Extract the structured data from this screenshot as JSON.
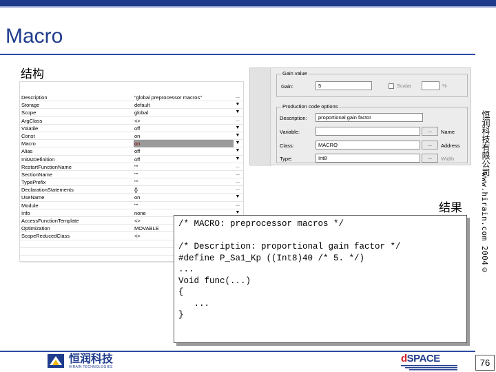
{
  "slide": {
    "title": "Macro",
    "section_heading": "结构",
    "result_heading": "结果",
    "company_vertical": "恒润科技有限公司",
    "url_vertical": "www.hirain.com 2004©",
    "page_number": "76"
  },
  "property_grid": {
    "rows": [
      {
        "name": "Description",
        "value": "\"global preprocessor macros\"",
        "control": "..."
      },
      {
        "name": "Storage",
        "value": "default",
        "control": "▼"
      },
      {
        "name": "Scope",
        "value": "global",
        "control": "▼"
      },
      {
        "name": "ArgClass",
        "value": "<>",
        "control": "..."
      },
      {
        "name": "Volatile",
        "value": "off",
        "control": "▼"
      },
      {
        "name": "Const",
        "value": "on",
        "control": "▼"
      },
      {
        "name": "Macro",
        "value": "on",
        "control": "▼",
        "highlight": true
      },
      {
        "name": "Alias",
        "value": "off",
        "control": "▼"
      },
      {
        "name": "InitAtDefinition",
        "value": "off",
        "control": "▼"
      },
      {
        "name": "RestartFunctionName",
        "value": "\"\"",
        "control": "..."
      },
      {
        "name": "SectionName",
        "value": "\"\"",
        "control": "..."
      },
      {
        "name": "TypePrefix",
        "value": "\"\"",
        "control": "..."
      },
      {
        "name": "DeclarationStatements",
        "value": "{}",
        "control": "..."
      },
      {
        "name": "UseName",
        "value": "on",
        "control": "▼"
      },
      {
        "name": "Module",
        "value": "\"\"",
        "control": "..."
      },
      {
        "name": "Info",
        "value": "none",
        "control": "▼"
      },
      {
        "name": "AccessFunctionTemplate",
        "value": "<>",
        "control": "..."
      },
      {
        "name": "Optimization",
        "value": "MOVABLE",
        "control": "..."
      },
      {
        "name": "ScopeReducedClass",
        "value": "<>",
        "control": "..."
      }
    ]
  },
  "gain_dialog": {
    "gain_group_title": "Gain value",
    "gain_label": "Gain:",
    "gain_value": "5",
    "scalar_label": "Scalar",
    "scalar_suffix": "%",
    "production_group_title": "Production code options",
    "description_label": "Description:",
    "description_value": "proportional gain factor",
    "variable_label": "Variable:",
    "variable_value": "",
    "class_label": "Class:",
    "class_value": "MACRO",
    "type_label": "Type:",
    "type_value": "Int8",
    "browse_label": "...",
    "name_label": "Name",
    "address_label": "Address",
    "width_label": "Width"
  },
  "code": {
    "lines": [
      "/* MACRO: preprocessor macros */",
      "",
      "/* Description: proportional gain factor */",
      "#define P_Sa1_Kp ((Int8)40 /* 5. */)",
      "...",
      "Void func(...)",
      "{",
      "   ...",
      "}"
    ]
  },
  "footer": {
    "logo_cn": "恒润科技",
    "logo_en": "HIRAIN TECHNOLOGIES",
    "dspace_prefix": "d",
    "dspace_suffix": "SPACE"
  },
  "colors": {
    "brand_blue": "#1f3c8c",
    "highlight_gray": "#9a9a9a",
    "dspace_red": "#d0202a"
  }
}
